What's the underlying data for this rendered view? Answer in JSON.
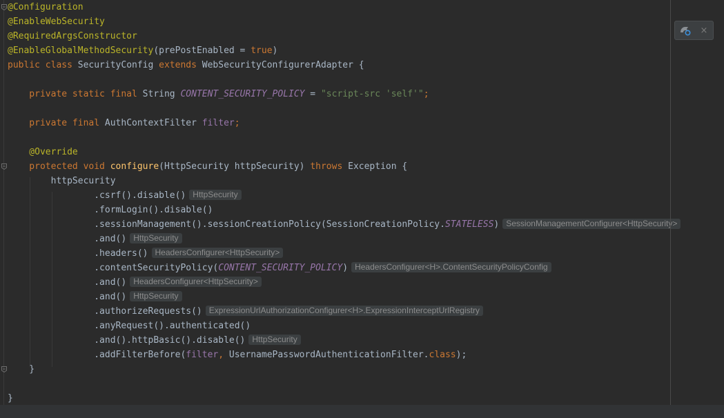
{
  "editor": {
    "lines": [
      {
        "tokens": [
          {
            "t": "@Configuration",
            "c": "ann"
          }
        ]
      },
      {
        "tokens": [
          {
            "t": "@EnableWebSecurity",
            "c": "ann"
          }
        ]
      },
      {
        "tokens": [
          {
            "t": "@RequiredArgsConstructor",
            "c": "ann"
          }
        ]
      },
      {
        "tokens": [
          {
            "t": "@EnableGlobalMethodSecurity",
            "c": "ann"
          },
          {
            "t": "(prePostEnabled = ",
            "c": "plain"
          },
          {
            "t": "true",
            "c": "kw"
          },
          {
            "t": ")",
            "c": "plain"
          }
        ]
      },
      {
        "tokens": [
          {
            "t": "public class ",
            "c": "kw"
          },
          {
            "t": "SecurityConfig ",
            "c": "plain"
          },
          {
            "t": "extends ",
            "c": "kw"
          },
          {
            "t": "WebSecurityConfigurerAdapter {",
            "c": "plain"
          }
        ]
      },
      {
        "tokens": []
      },
      {
        "tokens": [
          {
            "t": "    private static final ",
            "c": "kw"
          },
          {
            "t": "String ",
            "c": "plain"
          },
          {
            "t": "CONTENT_SECURITY_POLICY",
            "c": "ifield"
          },
          {
            "t": " = ",
            "c": "plain"
          },
          {
            "t": "\"script-src 'self'\"",
            "c": "str"
          },
          {
            "t": ";",
            "c": "kw"
          }
        ]
      },
      {
        "tokens": []
      },
      {
        "tokens": [
          {
            "t": "    private final ",
            "c": "kw"
          },
          {
            "t": "AuthContextFilter ",
            "c": "plain"
          },
          {
            "t": "filter",
            "c": "field"
          },
          {
            "t": ";",
            "c": "kw"
          }
        ]
      },
      {
        "tokens": []
      },
      {
        "tokens": [
          {
            "t": "    @Override",
            "c": "ann"
          }
        ]
      },
      {
        "tokens": [
          {
            "t": "    protected void ",
            "c": "kw"
          },
          {
            "t": "configure",
            "c": "fn"
          },
          {
            "t": "(HttpSecurity httpSecurity) ",
            "c": "plain"
          },
          {
            "t": "throws ",
            "c": "kw"
          },
          {
            "t": "Exception {",
            "c": "plain"
          }
        ]
      },
      {
        "tokens": [
          {
            "t": "        httpSecurity",
            "c": "plain"
          }
        ]
      },
      {
        "tokens": [
          {
            "t": "                .csrf().disable()",
            "c": "plain"
          }
        ],
        "hint": "HttpSecurity"
      },
      {
        "tokens": [
          {
            "t": "                .formLogin().disable()",
            "c": "plain"
          }
        ]
      },
      {
        "tokens": [
          {
            "t": "                .sessionManagement().sessionCreationPolicy(SessionCreationPolicy.",
            "c": "plain"
          },
          {
            "t": "STATELESS",
            "c": "ifield"
          },
          {
            "t": ")",
            "c": "plain"
          }
        ],
        "hint": "SessionManagementConfigurer<HttpSecurity>"
      },
      {
        "tokens": [
          {
            "t": "                .and()",
            "c": "plain"
          }
        ],
        "hint": "HttpSecurity"
      },
      {
        "tokens": [
          {
            "t": "                .headers()",
            "c": "plain"
          }
        ],
        "hint": "HeadersConfigurer<HttpSecurity>"
      },
      {
        "tokens": [
          {
            "t": "                .contentSecurityPolicy(",
            "c": "plain"
          },
          {
            "t": "CONTENT_SECURITY_POLICY",
            "c": "ifield"
          },
          {
            "t": ")",
            "c": "plain"
          }
        ],
        "hint": "HeadersConfigurer<H>.ContentSecurityPolicyConfig"
      },
      {
        "tokens": [
          {
            "t": "                .and()",
            "c": "plain"
          }
        ],
        "hint": "HeadersConfigurer<HttpSecurity>"
      },
      {
        "tokens": [
          {
            "t": "                .and()",
            "c": "plain"
          }
        ],
        "hint": "HttpSecurity"
      },
      {
        "tokens": [
          {
            "t": "                .authorizeRequests()",
            "c": "plain"
          }
        ],
        "hint": "ExpressionUrlAuthorizationConfigurer<H>.ExpressionInterceptUrlRegistry"
      },
      {
        "tokens": [
          {
            "t": "                .anyRequest().authenticated()",
            "c": "plain"
          }
        ]
      },
      {
        "tokens": [
          {
            "t": "                .and().httpBasic().disable()",
            "c": "plain"
          }
        ],
        "hint": "HttpSecurity"
      },
      {
        "tokens": [
          {
            "t": "                .addFilterBefore(",
            "c": "plain"
          },
          {
            "t": "filter",
            "c": "field"
          },
          {
            "t": ", ",
            "c": "kw"
          },
          {
            "t": "UsernamePasswordAuthenticationFilter.",
            "c": "plain"
          },
          {
            "t": "class",
            "c": "kw"
          },
          {
            "t": ");",
            "c": "plain"
          }
        ]
      },
      {
        "tokens": [
          {
            "t": "    }",
            "c": "plain"
          }
        ]
      },
      {
        "tokens": []
      },
      {
        "tokens": [
          {
            "t": "}",
            "c": "plain"
          }
        ]
      }
    ],
    "fold_marker_lines": [
      0,
      11,
      25
    ]
  },
  "toolbar": {
    "reload_icon": "reload-maven-icon",
    "close_icon": "close-icon",
    "close_glyph": "×"
  },
  "colors": {
    "background": "#2b2b2b",
    "annotation": "#bbb529",
    "keyword": "#cc7832",
    "function": "#ffc66d",
    "field": "#9876aa",
    "string": "#6a8759",
    "text": "#a9b7c6"
  }
}
